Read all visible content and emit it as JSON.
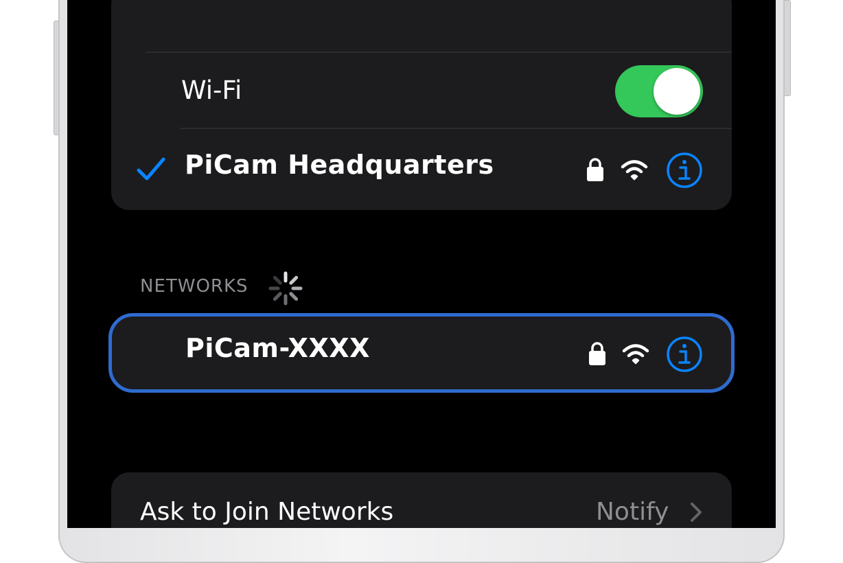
{
  "wifi_section": {
    "label": "Wi-Fi",
    "toggle_on": true
  },
  "connected_network": {
    "name": "PiCam Headquarters",
    "connected": true,
    "secured": true,
    "icons": [
      "checkmark-icon",
      "lock-icon",
      "wifi-signal-icon",
      "info-icon"
    ]
  },
  "networks_section": {
    "header": "NETWORKS",
    "scanning": true
  },
  "available_networks": [
    {
      "name": "PiCam-XXXX",
      "secured": true,
      "highlighted": true
    }
  ],
  "ask_to_join": {
    "label": "Ask to Join Networks",
    "value": "Notify"
  },
  "colors": {
    "accent": "#0a84ff",
    "toggle_on": "#34c759",
    "highlight_outline": "#2f6bd0",
    "cell_background": "#1c1c1e",
    "secondary_text": "#8e8e93"
  }
}
